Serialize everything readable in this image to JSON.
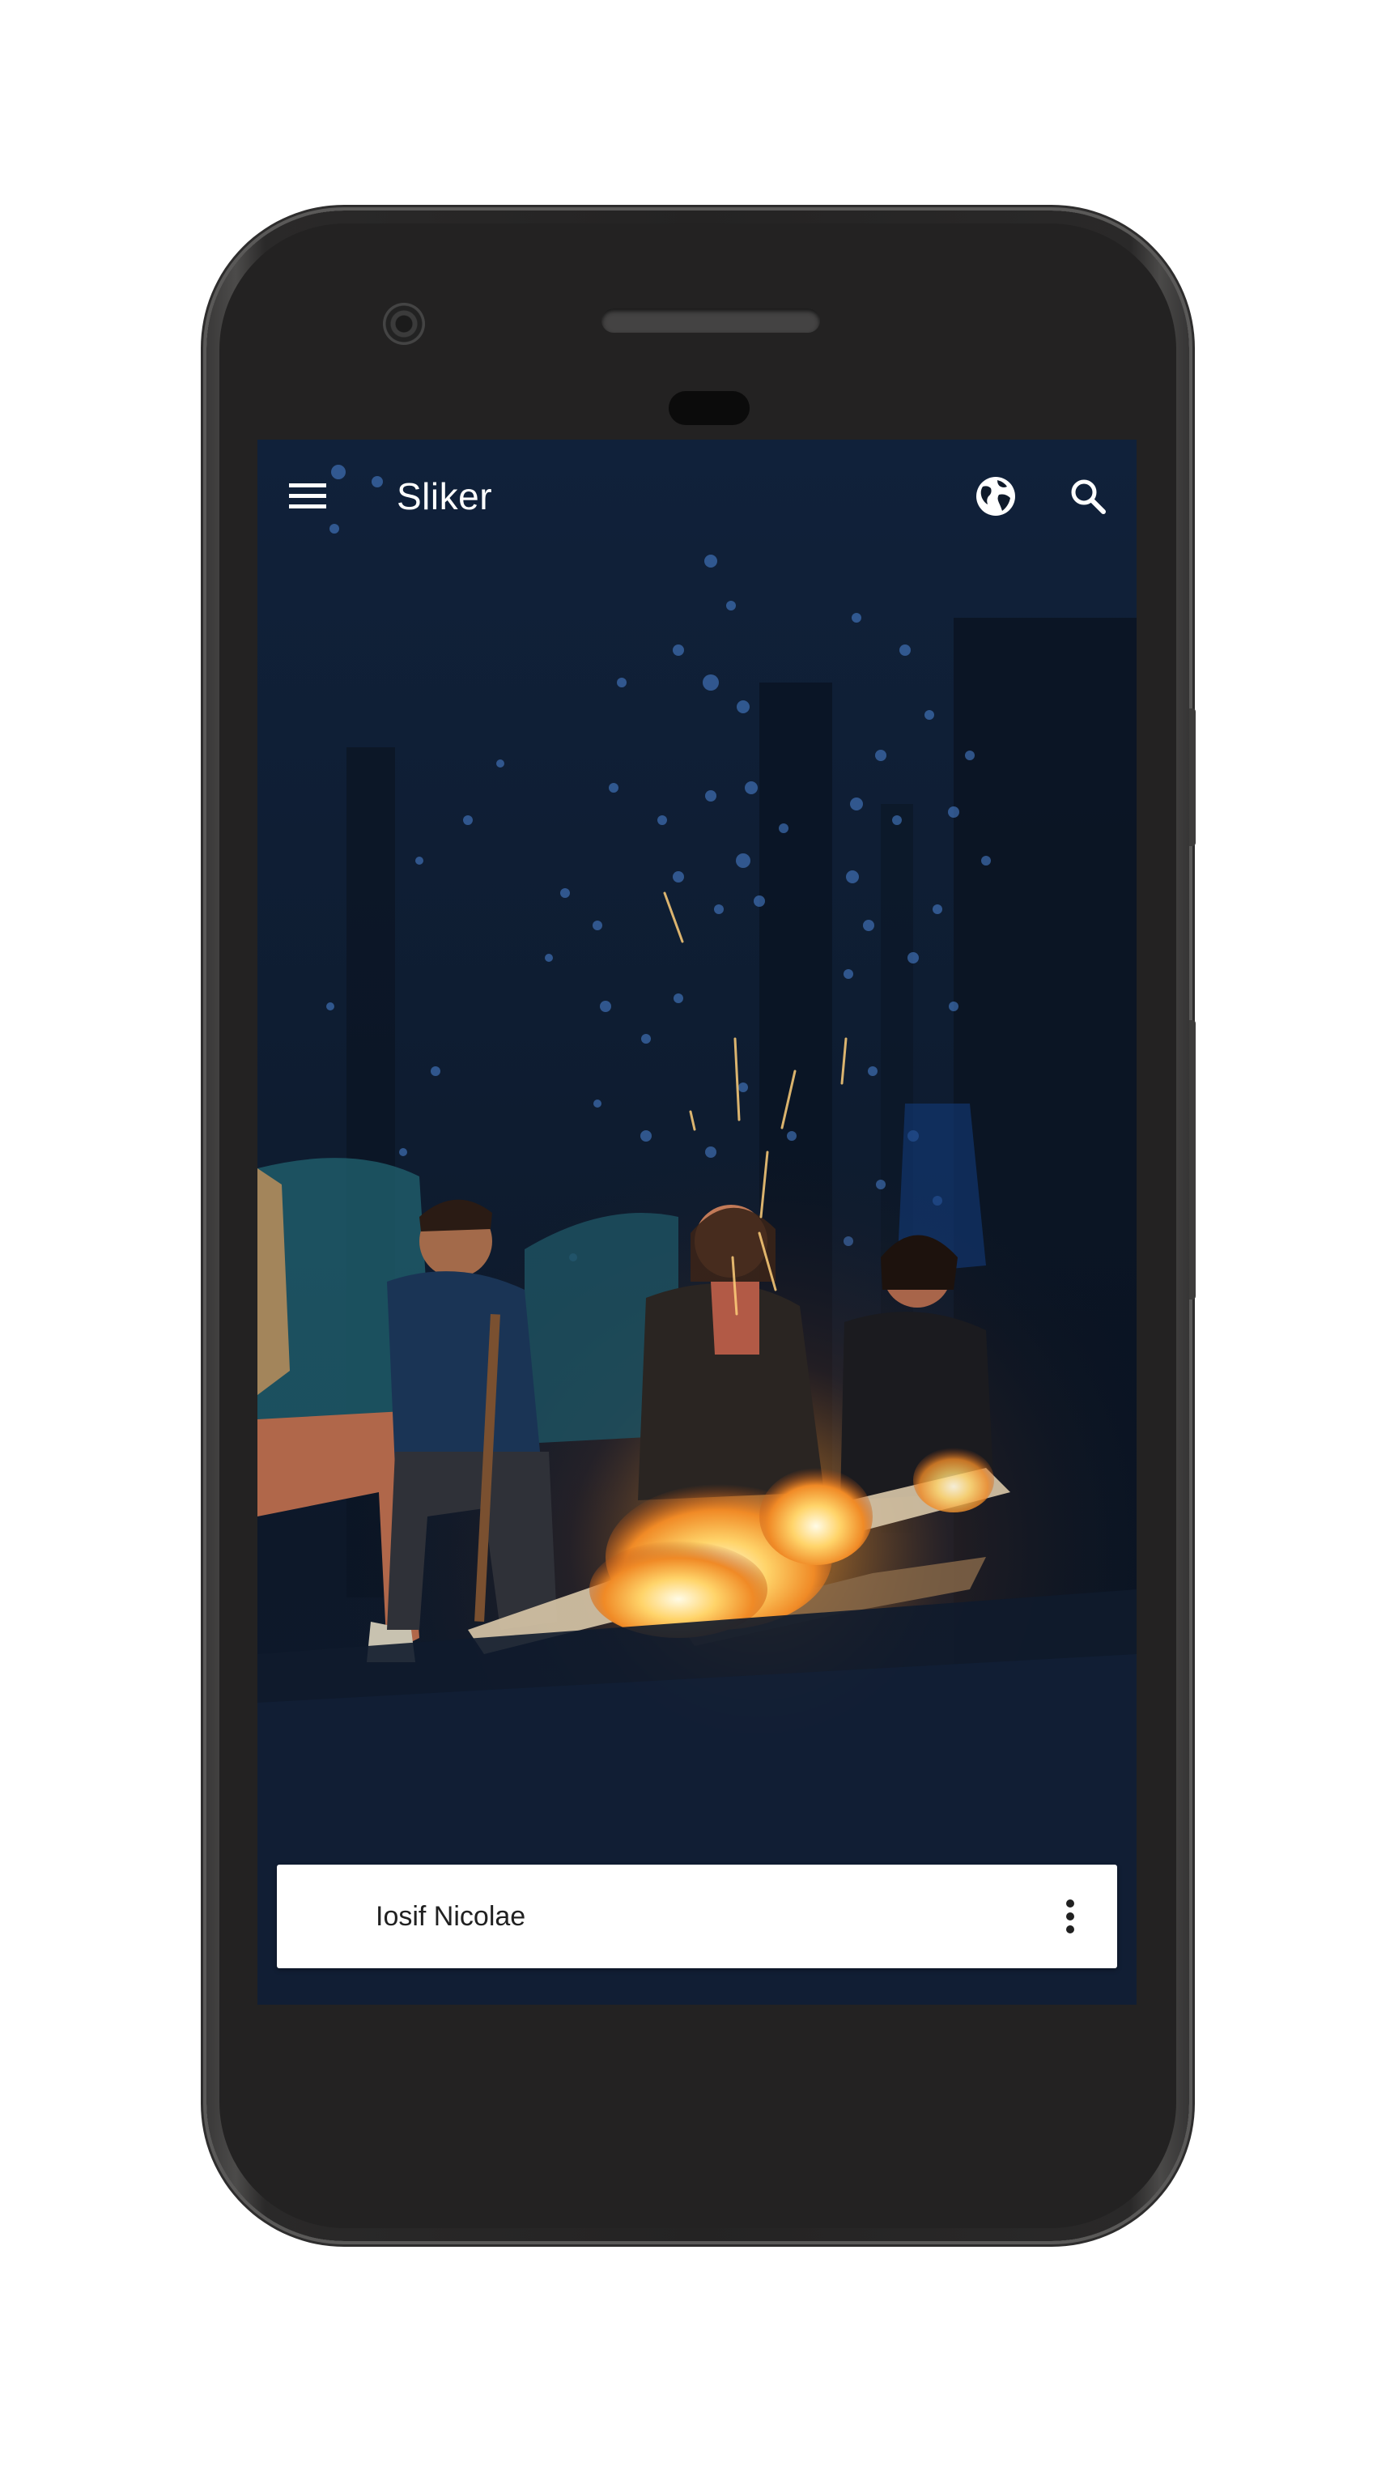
{
  "app": {
    "title": "Sliker"
  },
  "appbar": {
    "menu_icon": "hamburger-menu-icon",
    "globe_icon": "globe-icon",
    "search_icon": "search-icon"
  },
  "photo": {
    "subject": "people around campfire at night in forest"
  },
  "author_card": {
    "name": "Iosif Nicolae",
    "more_icon": "more-vert-icon"
  },
  "colors": {
    "appbar_text": "#ffffff",
    "card_background": "#ffffff",
    "card_text": "#212121",
    "phone_body": "#232222"
  }
}
